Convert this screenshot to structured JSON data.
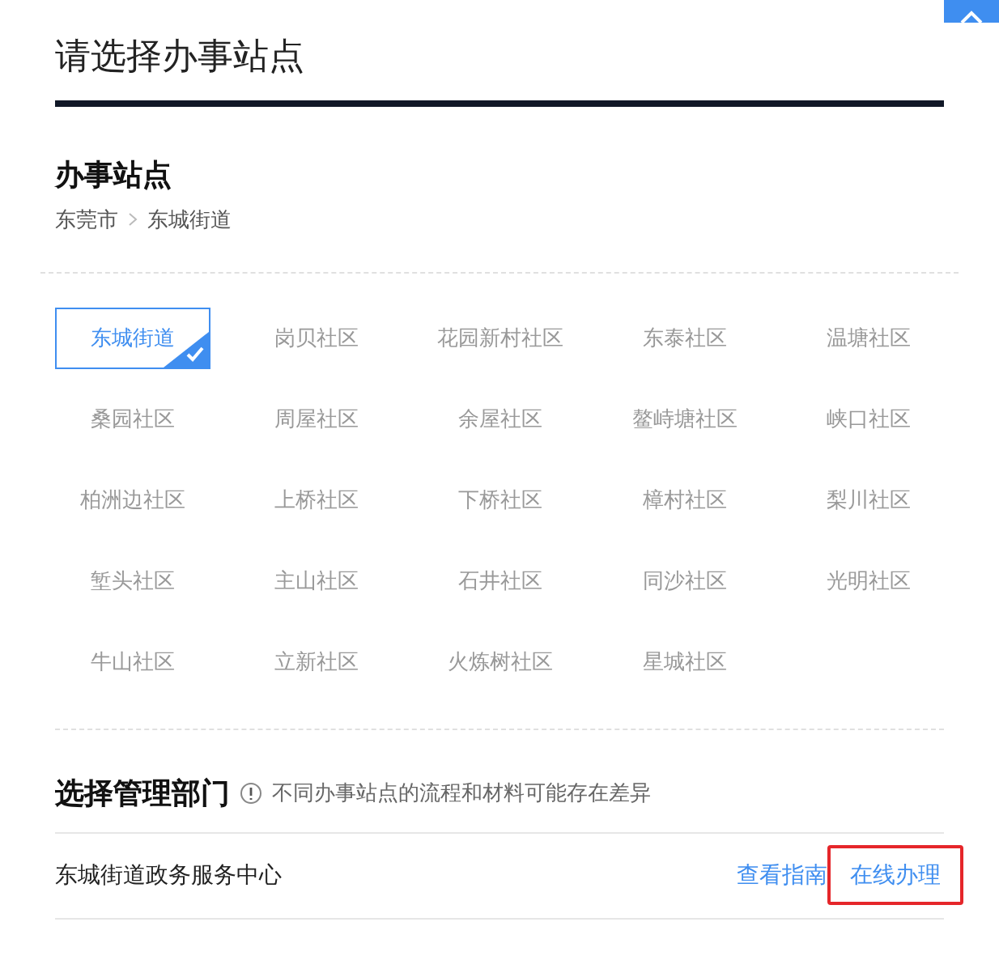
{
  "dialog": {
    "title": "请选择办事站点"
  },
  "station_section": {
    "title": "办事站点",
    "breadcrumb": [
      "东莞市",
      "东城街道"
    ]
  },
  "stations": [
    {
      "label": "东城街道",
      "selected": true
    },
    {
      "label": "岗贝社区",
      "selected": false
    },
    {
      "label": "花园新村社区",
      "selected": false
    },
    {
      "label": "东泰社区",
      "selected": false
    },
    {
      "label": "温塘社区",
      "selected": false
    },
    {
      "label": "桑园社区",
      "selected": false
    },
    {
      "label": "周屋社区",
      "selected": false
    },
    {
      "label": "余屋社区",
      "selected": false
    },
    {
      "label": "鳌峙塘社区",
      "selected": false
    },
    {
      "label": "峡口社区",
      "selected": false
    },
    {
      "label": "柏洲边社区",
      "selected": false
    },
    {
      "label": "上桥社区",
      "selected": false
    },
    {
      "label": "下桥社区",
      "selected": false
    },
    {
      "label": "樟村社区",
      "selected": false
    },
    {
      "label": "梨川社区",
      "selected": false
    },
    {
      "label": "堑头社区",
      "selected": false
    },
    {
      "label": "主山社区",
      "selected": false
    },
    {
      "label": "石井社区",
      "selected": false
    },
    {
      "label": "同沙社区",
      "selected": false
    },
    {
      "label": "光明社区",
      "selected": false
    },
    {
      "label": "牛山社区",
      "selected": false
    },
    {
      "label": "立新社区",
      "selected": false
    },
    {
      "label": "火炼树社区",
      "selected": false
    },
    {
      "label": "星城社区",
      "selected": false
    }
  ],
  "department_section": {
    "title": "选择管理部门",
    "note": "不同办事站点的流程和材料可能存在差异"
  },
  "departments": [
    {
      "name": "东城街道政务服务中心",
      "actions": [
        {
          "label": "查看指南",
          "highlighted": false
        },
        {
          "label": "在线办理",
          "highlighted": true
        }
      ]
    }
  ]
}
